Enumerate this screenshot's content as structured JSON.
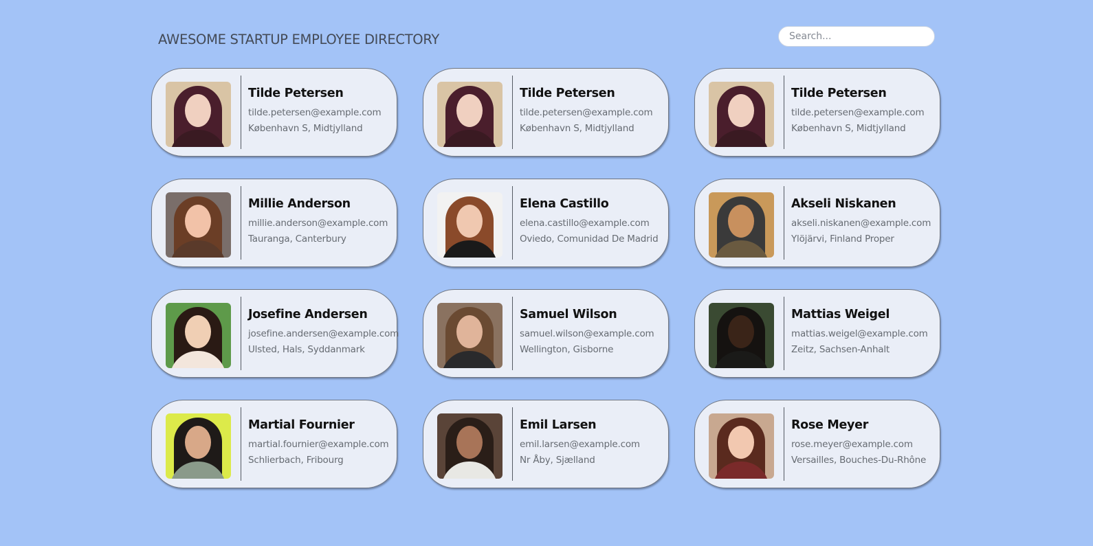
{
  "header": {
    "title": "AWESOME STARTUP EMPLOYEE DIRECTORY",
    "search_placeholder": "Search..."
  },
  "employees": [
    {
      "name": "Tilde Petersen",
      "email": "tilde.petersen@example.com",
      "location": "København S, Midtjylland",
      "photo": {
        "bg": "#d9c4a5",
        "hair": "#4a1e2c",
        "skin": "#f0d0c0",
        "shirt": "#3a1a22"
      }
    },
    {
      "name": "Tilde Petersen",
      "email": "tilde.petersen@example.com",
      "location": "København S, Midtjylland",
      "photo": {
        "bg": "#d9c4a5",
        "hair": "#4a1e2c",
        "skin": "#f0d0c0",
        "shirt": "#3a1a22"
      }
    },
    {
      "name": "Tilde Petersen",
      "email": "tilde.petersen@example.com",
      "location": "København S, Midtjylland",
      "photo": {
        "bg": "#d9c4a5",
        "hair": "#4a1e2c",
        "skin": "#f0d0c0",
        "shirt": "#3a1a22"
      }
    },
    {
      "name": "Millie Anderson",
      "email": "millie.anderson@example.com",
      "location": "Tauranga, Canterbury",
      "photo": {
        "bg": "#7a6e6a",
        "hair": "#6b3e26",
        "skin": "#f2c2a8",
        "shirt": "#5a3a2a"
      }
    },
    {
      "name": "Elena Castillo",
      "email": "elena.castillo@example.com",
      "location": "Oviedo, Comunidad De Madrid",
      "photo": {
        "bg": "#f2f2f2",
        "hair": "#8a4a2a",
        "skin": "#f0c8b0",
        "shirt": "#1a1a1a"
      }
    },
    {
      "name": "Akseli Niskanen",
      "email": "akseli.niskanen@example.com",
      "location": "Ylöjärvi, Finland Proper",
      "photo": {
        "bg": "#c9995a",
        "hair": "#3a3a3a",
        "skin": "#c8905e",
        "shirt": "#6a5a40"
      }
    },
    {
      "name": "Josefine Andersen",
      "email": "josefine.andersen@example.com",
      "location": "Ulsted, Hals, Syddanmark",
      "photo": {
        "bg": "#5e9a4a",
        "hair": "#2a1a14",
        "skin": "#f0cfb4",
        "shirt": "#f3e6dc"
      }
    },
    {
      "name": "Samuel Wilson",
      "email": "samuel.wilson@example.com",
      "location": "Wellington, Gisborne",
      "photo": {
        "bg": "#8a7260",
        "hair": "#6a4a32",
        "skin": "#e0b49a",
        "shirt": "#2a2a2c"
      }
    },
    {
      "name": "Mattias Weigel",
      "email": "mattias.weigel@example.com",
      "location": "Zeitz, Sachsen-Anhalt",
      "photo": {
        "bg": "#3a4a32",
        "hair": "#151210",
        "skin": "#3a2418",
        "shirt": "#1a1a18"
      }
    },
    {
      "name": "Martial Fournier",
      "email": "martial.fournier@example.com",
      "location": "Schlierbach, Fribourg",
      "photo": {
        "bg": "#dcea4a",
        "hair": "#1e1a18",
        "skin": "#d8a888",
        "shirt": "#8a9a8a"
      }
    },
    {
      "name": "Emil Larsen",
      "email": "emil.larsen@example.com",
      "location": "Nr Åby, Sjælland",
      "photo": {
        "bg": "#5a4438",
        "hair": "#2a1e18",
        "skin": "#a87458",
        "shirt": "#e8e8e4"
      }
    },
    {
      "name": "Rose Meyer",
      "email": "rose.meyer@example.com",
      "location": "Versailles, Bouches-Du-Rhône",
      "photo": {
        "bg": "#c8a890",
        "hair": "#5a2a1e",
        "skin": "#f2c8b0",
        "shirt": "#7a2a2a"
      }
    }
  ]
}
